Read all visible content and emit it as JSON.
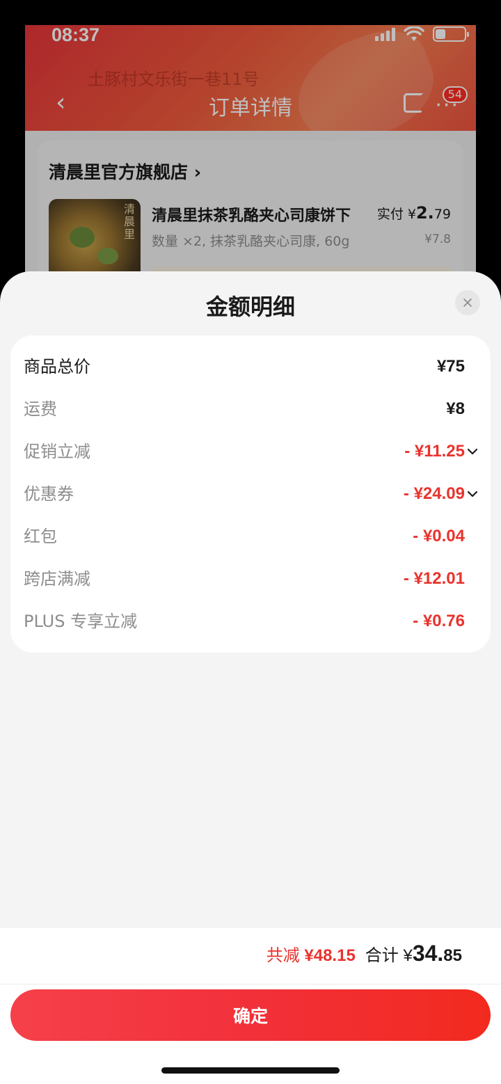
{
  "status_bar": {
    "time": "08:37"
  },
  "background": {
    "address": "土豚村文乐街一巷11号",
    "title": "订单详情",
    "badge": "54",
    "store_name": "清晨里官方旗舰店 ›",
    "product_name": "清晨里抹茶乳酪夹心司康饼下",
    "product_spec": "数量 ×2, 抹茶乳酪夹心司康, 60g",
    "paid_label": "实付 ¥",
    "paid_int": "2.",
    "paid_dec": "79",
    "original_price": "¥7.8",
    "thumb_mark": "清晨里"
  },
  "sheet": {
    "title": "金额明细",
    "rows": [
      {
        "label": "商品总价",
        "value": "¥75"
      },
      {
        "label": "运费",
        "value": "¥8"
      },
      {
        "label": "促销立减",
        "value": "- ¥11.25"
      },
      {
        "label": "优惠券",
        "value": "- ¥24.09"
      },
      {
        "label": "红包",
        "value": "- ¥0.04"
      },
      {
        "label": "跨店满减",
        "value": "- ¥12.01"
      },
      {
        "label": "PLUS 专享立减",
        "value": "- ¥0.76"
      }
    ],
    "saved_label": "共减",
    "saved_value": "¥48.15",
    "total_label": "合计 ¥",
    "total_int": "34.",
    "total_dec": "85",
    "confirm_label": "确定"
  },
  "colors": {
    "accent": "#e8332d",
    "button": "#f2303a"
  }
}
